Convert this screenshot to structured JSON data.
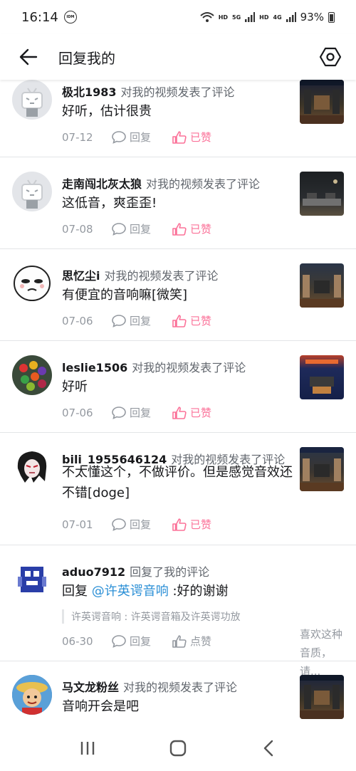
{
  "status": {
    "time": "16:14",
    "idm": "IDM",
    "hd1": "HD",
    "net1": "5G",
    "hd2": "HD",
    "net2": "4G",
    "battery": "93%"
  },
  "header": {
    "title": "回复我的",
    "back_icon": "arrow-left-icon",
    "settings_icon": "hexagon-settings-icon"
  },
  "labels": {
    "reply": "回复",
    "liked": "已赞",
    "like": "点赞"
  },
  "colors": {
    "liked": "#fb7299",
    "mention": "#2b8fd6",
    "secondary": "#9499a0"
  },
  "items": [
    {
      "username": "极北1983",
      "action": "对我的视频发表了评论",
      "content": "好听，估计很贵",
      "date": "07-12",
      "liked": true
    },
    {
      "username": "走南闯北灰太狼",
      "action": "对我的视频发表了评论",
      "content": "这低音，爽歪歪!",
      "date": "07-08",
      "liked": true
    },
    {
      "username": "思忆尘i",
      "action": "对我的视频发表了评论",
      "content": "有便宜的音响嘛[微笑]",
      "date": "07-06",
      "liked": true
    },
    {
      "username": "leslie1506",
      "action": "对我的视频发表了评论",
      "content": "好听",
      "date": "07-06",
      "liked": true
    },
    {
      "username": "bili_1955646124",
      "action": "对我的视频发表了评论",
      "content": "不太懂这个，不做评价。但是感觉音效还不错[doge]",
      "date": "07-01",
      "liked": true
    },
    {
      "username": "aduo7912",
      "action": "回复了我的评论",
      "reply_prefix": "回复 ",
      "mention": "@许英谔音响",
      "reply_text": " :好的谢谢",
      "quote": "许英谔音响 : 许英谔音箱及许英谔功放",
      "date": "06-30",
      "liked": false,
      "side_text": "喜欢这种音质，请..."
    },
    {
      "username": "马文龙粉丝",
      "action": "对我的视频发表了评论",
      "content": "音响开会是吧"
    }
  ]
}
